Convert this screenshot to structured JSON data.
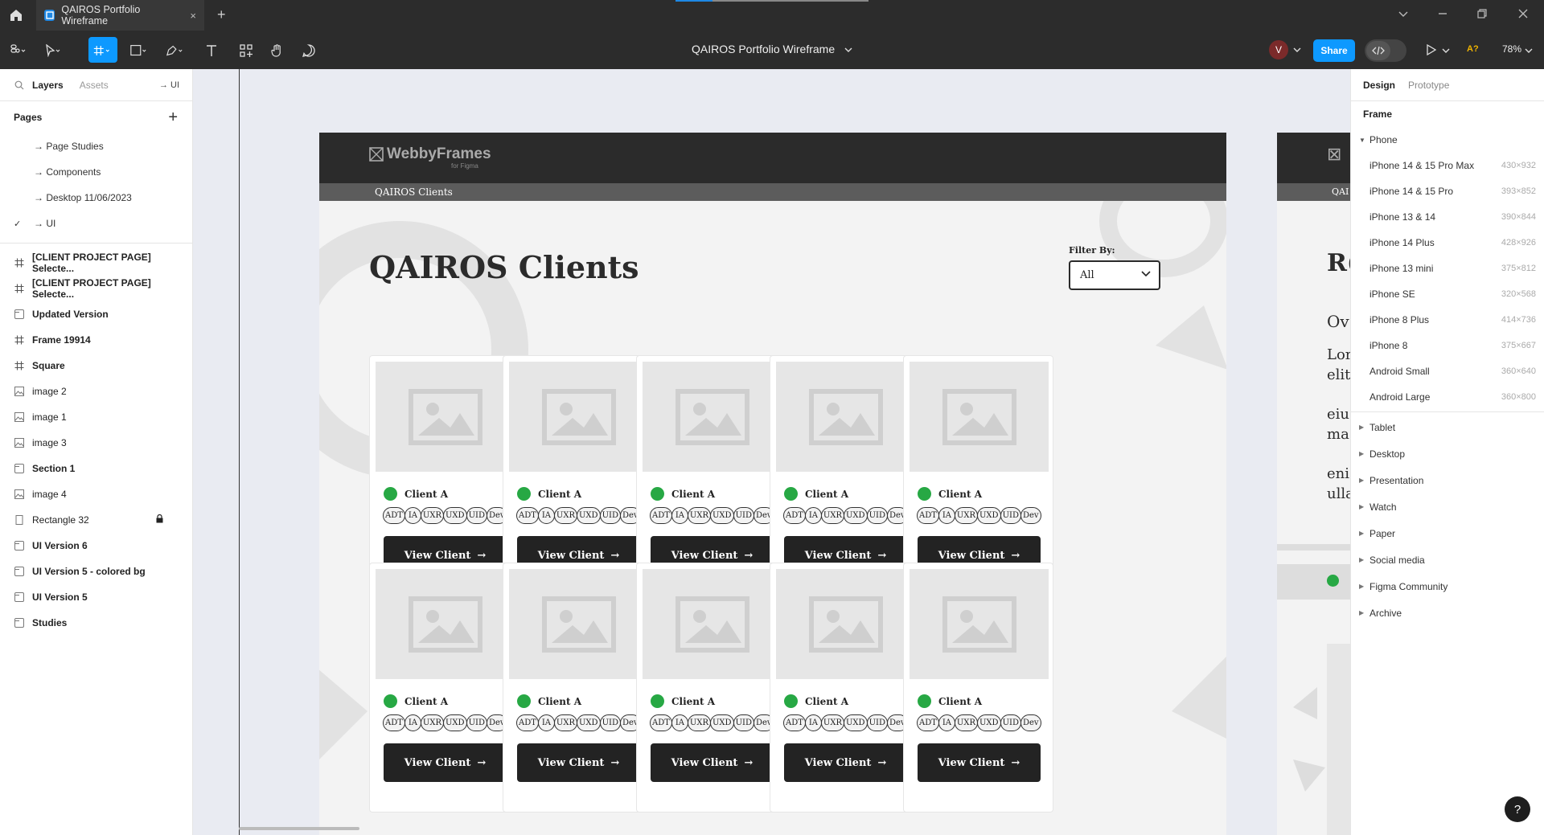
{
  "window": {
    "tab_title": "QAIROS Portfolio Wireframe",
    "tab_close": "×",
    "new_tab": "+"
  },
  "toolbar": {
    "doc_title": "QAIROS Portfolio Wireframe",
    "avatar_letter": "V",
    "share_label": "Share",
    "zoom": "78%",
    "font_warning": "A?"
  },
  "left_panel": {
    "tabs": [
      "Layers",
      "Assets"
    ],
    "page_indicator": "→ UI",
    "pages_title": "Pages",
    "pages": [
      {
        "label": "→ Page Studies",
        "checked": ""
      },
      {
        "label": "→ Components",
        "checked": ""
      },
      {
        "label": "→ Desktop 11/06/2023",
        "checked": ""
      },
      {
        "label": "→ UI",
        "checked": "✓"
      }
    ],
    "layers": [
      {
        "label": "[CLIENT PROJECT PAGE] Selecte...",
        "icon": "#",
        "bold": true
      },
      {
        "label": "[CLIENT PROJECT PAGE] Selecte...",
        "icon": "#",
        "bold": true
      },
      {
        "label": "Updated Version",
        "icon": "section",
        "bold": true
      },
      {
        "label": "Frame 19914",
        "icon": "#",
        "bold": true
      },
      {
        "label": "Square",
        "icon": "#",
        "bold": true
      },
      {
        "label": "image 2",
        "icon": "image",
        "bold": false
      },
      {
        "label": "image 1",
        "icon": "image",
        "bold": false
      },
      {
        "label": "image 3",
        "icon": "image",
        "bold": false
      },
      {
        "label": "Section 1",
        "icon": "section",
        "bold": true
      },
      {
        "label": "image 4",
        "icon": "image",
        "bold": false
      },
      {
        "label": "Rectangle 32",
        "icon": "rect",
        "bold": false,
        "locked": true
      },
      {
        "label": "UI Version 6",
        "icon": "section",
        "bold": true
      },
      {
        "label": "UI Version 5 - colored bg",
        "icon": "section",
        "bold": true
      },
      {
        "label": "UI Version 5",
        "icon": "section",
        "bold": true
      },
      {
        "label": "Studies",
        "icon": "section",
        "bold": true
      }
    ]
  },
  "frame": {
    "logo": "WebbyFrames",
    "logo_sub": "for Figma",
    "nav_title": "QAIROS Clients",
    "heading": "QAIROS Clients",
    "filter_label": "Filter By:",
    "filter_value": "All",
    "card": {
      "client_name": "Client A",
      "tags": [
        "ADT",
        "IA",
        "UXR",
        "UXD",
        "UID",
        "Dev"
      ],
      "button_label": "View Client",
      "button_arrow": "→"
    },
    "rows": 2,
    "cols": 5
  },
  "frame2": {
    "logo_fragment": "⊠",
    "nav_fragment": "QAI",
    "heading_fragment": "R(",
    "sub_fragment": "Ov",
    "lines": [
      "Lor",
      "elit",
      "eiu",
      "ma",
      "eni",
      "ulla"
    ]
  },
  "right_panel": {
    "tabs": [
      "Design",
      "Prototype"
    ],
    "section_title": "Frame",
    "open_group": "Phone",
    "devices": [
      {
        "name": "iPhone 14 & 15 Pro Max",
        "size": "430×932"
      },
      {
        "name": "iPhone 14 & 15 Pro",
        "size": "393×852"
      },
      {
        "name": "iPhone 13 & 14",
        "size": "390×844"
      },
      {
        "name": "iPhone 14 Plus",
        "size": "428×926"
      },
      {
        "name": "iPhone 13 mini",
        "size": "375×812"
      },
      {
        "name": "iPhone SE",
        "size": "320×568"
      },
      {
        "name": "iPhone 8 Plus",
        "size": "414×736"
      },
      {
        "name": "iPhone 8",
        "size": "375×667"
      },
      {
        "name": "Android Small",
        "size": "360×640"
      },
      {
        "name": "Android Large",
        "size": "360×800"
      }
    ],
    "categories": [
      "Tablet",
      "Desktop",
      "Presentation",
      "Watch",
      "Paper",
      "Social media",
      "Figma Community",
      "Archive"
    ]
  },
  "help": "?",
  "colors": {
    "accent": "#0d99ff",
    "status_dot": "#27a844",
    "dark": "#2b2b2b"
  }
}
